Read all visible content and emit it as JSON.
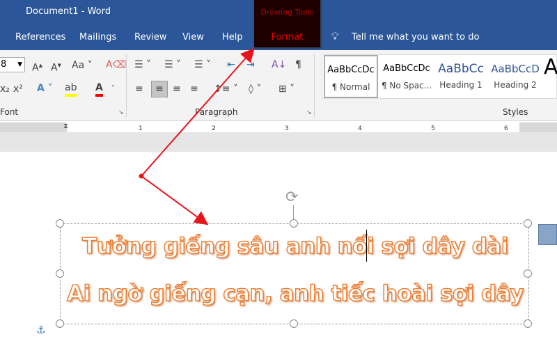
{
  "window": {
    "title": "Document1  -  Word"
  },
  "tabs": [
    "References",
    "Mailings",
    "Review",
    "View",
    "Help"
  ],
  "contextual": {
    "group": "Drawing Tools",
    "tab": "Format",
    "color": "#e00000"
  },
  "tellme": "Tell me what you want to do",
  "font": {
    "size": "8",
    "label": "Font"
  },
  "paragraph": {
    "label": "Paragraph"
  },
  "styles": {
    "label": "Styles",
    "items": [
      {
        "preview": "AaBbCcDc",
        "label": "¶ Normal"
      },
      {
        "preview": "AaBbCcDc",
        "label": "¶ No Spac..."
      },
      {
        "preview": "AaBbCc",
        "label": "Heading 1"
      },
      {
        "preview": "AaBbCcD",
        "label": "Heading 2"
      }
    ]
  },
  "ruler": [
    "1",
    "2",
    "3",
    "4",
    "5",
    "6"
  ],
  "wordart": {
    "lines": [
      "Tưởng giếng sâu anh nối sợi dây dài",
      "Ai ngờ giếng cạn, anh tiếc hoài sợi dây"
    ],
    "outline_color": "#ed7d31"
  },
  "annotation": {
    "color": "#e8141c"
  }
}
